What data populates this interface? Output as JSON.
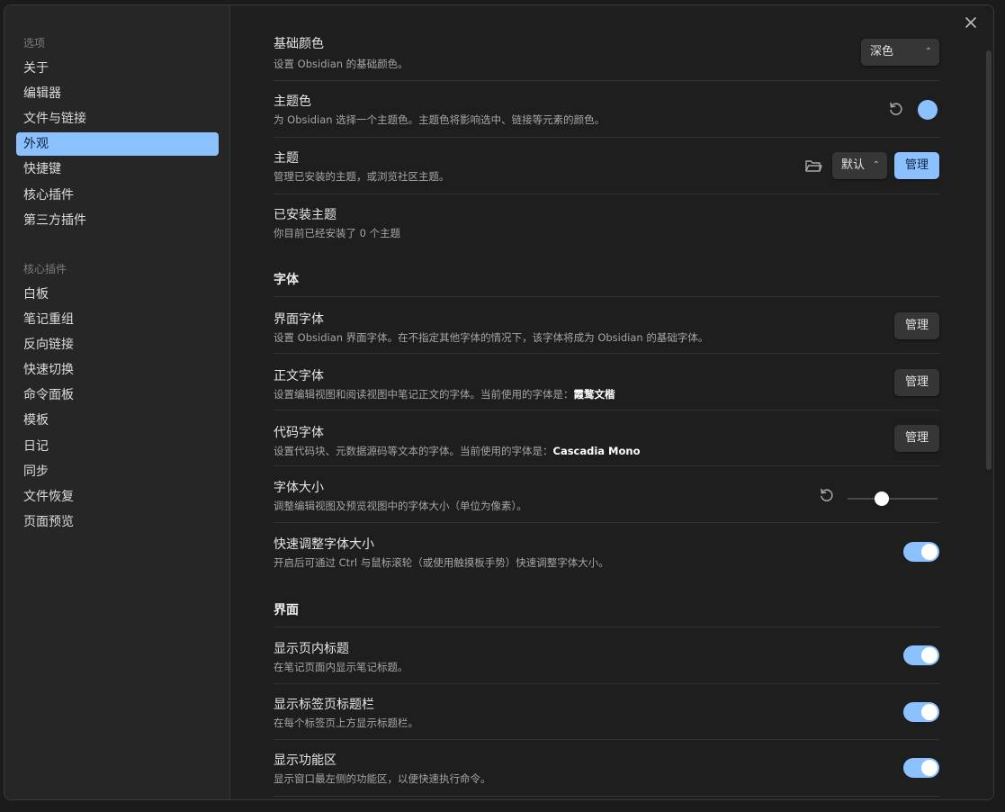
{
  "sidebar": {
    "options_heading": "选项",
    "options_items": [
      "关于",
      "编辑器",
      "文件与链接",
      "外观",
      "快捷键",
      "核心插件",
      "第三方插件"
    ],
    "core_heading": "核心插件",
    "core_items": [
      "白板",
      "笔记重组",
      "反向链接",
      "快速切换",
      "命令面板",
      "模板",
      "日记",
      "同步",
      "文件恢复",
      "页面预览"
    ],
    "active_item": "外观"
  },
  "close_icon": "close-icon",
  "settings": {
    "base_color": {
      "title": "基础颜色",
      "desc": "设置 Obsidian 的基础颜色。",
      "value": "深色"
    },
    "accent_color": {
      "title": "主题色",
      "desc": "为 Obsidian 选择一个主题色。主题色将影响选中、链接等元素的颜色。",
      "color": "#8cc1ff"
    },
    "theme": {
      "title": "主题",
      "desc": "管理已安装的主题，或浏览社区主题。",
      "value": "默认",
      "manage_label": "管理"
    },
    "installed_themes": {
      "title": "已安装主题",
      "desc": "你目前已经安装了 0 个主题"
    },
    "font_section": "字体",
    "interface_font": {
      "title": "界面字体",
      "desc": "设置 Obsidian 界面字体。在不指定其他字体的情况下，该字体将成为 Obsidian 的基础字体。",
      "manage_label": "管理"
    },
    "text_font": {
      "title": "正文字体",
      "desc": "设置编辑视图和阅读视图中笔记正文的字体。当前使用的字体是：",
      "current": "霞鹜文楷",
      "manage_label": "管理"
    },
    "mono_font": {
      "title": "代码字体",
      "desc": "设置代码块、元数据源码等文本的字体。当前使用的字体是：",
      "current": "Cascadia Mono",
      "manage_label": "管理"
    },
    "font_size": {
      "title": "字体大小",
      "desc": "调整编辑视图及预览视图中的字体大小（单位为像素）。",
      "slider_fraction": 0.38
    },
    "quick_font_size": {
      "title": "快速调整字体大小",
      "desc": "开启后可通过 Ctrl 与鼠标滚轮（或使用触摸板手势）快速调整字体大小。",
      "enabled": true
    },
    "interface_section": "界面",
    "show_inline_title": {
      "title": "显示页内标题",
      "desc": "在笔记页面内显示笔记标题。",
      "enabled": true
    },
    "show_tab_title_bar": {
      "title": "显示标签页标题栏",
      "desc": "在每个标签页上方显示标题栏。",
      "enabled": true
    },
    "show_ribbon": {
      "title": "显示功能区",
      "desc": "显示窗口最左侧的功能区，以便快速执行命令。",
      "enabled": true
    }
  }
}
